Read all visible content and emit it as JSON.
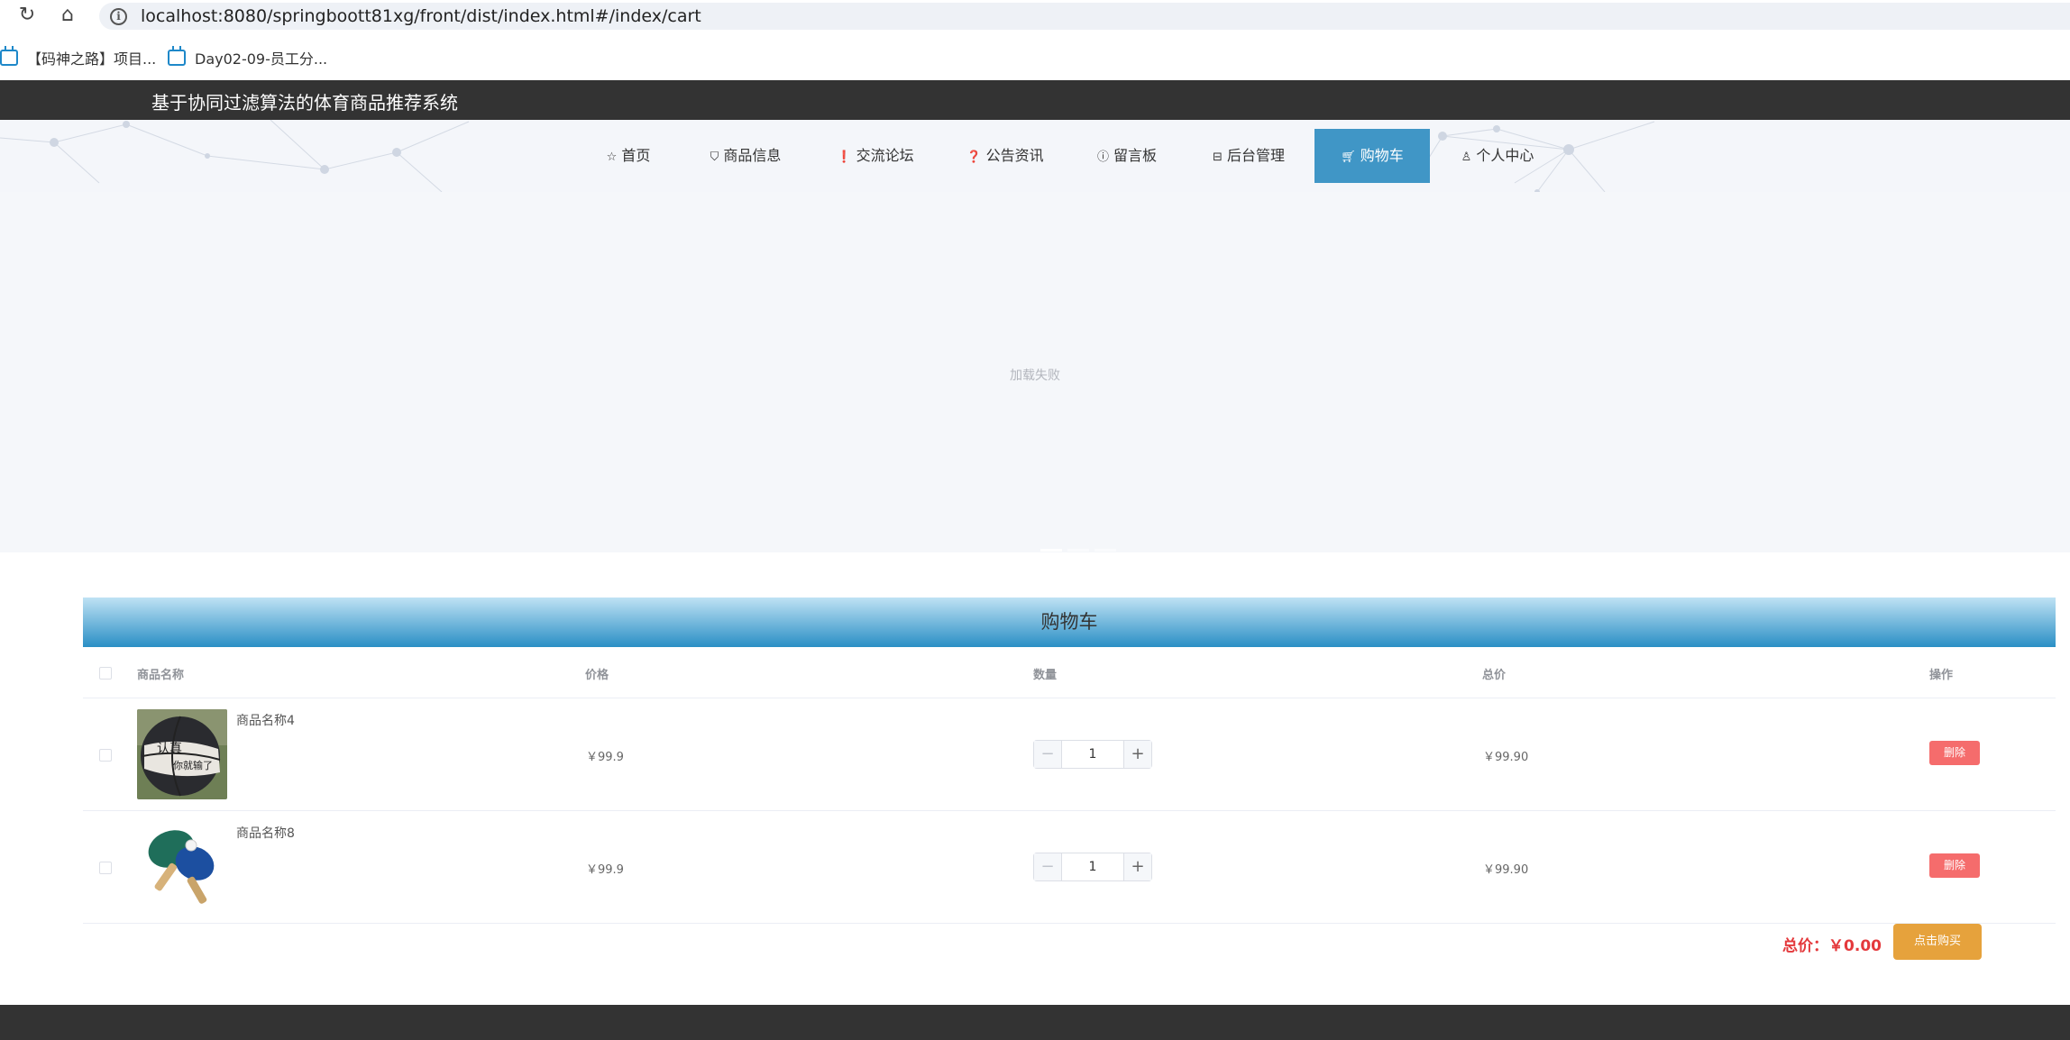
{
  "browser": {
    "url": "localhost:8080/springboott81xg/front/dist/index.html#/index/cart",
    "bookmarks": [
      "【码神之路】项目...",
      "Day02-09-员工分..."
    ]
  },
  "site": {
    "title": "基于协同过滤算法的体育商品推荐系统",
    "nav": [
      {
        "label": "首页",
        "icon": "star-icon"
      },
      {
        "label": "商品信息",
        "icon": "bag-icon"
      },
      {
        "label": "交流论坛",
        "icon": "exclamation-icon"
      },
      {
        "label": "公告资讯",
        "icon": "question-icon"
      },
      {
        "label": "留言板",
        "icon": "info-icon"
      },
      {
        "label": "后台管理",
        "icon": "briefcase-icon"
      },
      {
        "label": "购物车",
        "icon": "cart-icon",
        "active": true
      },
      {
        "label": "个人中心",
        "icon": "user-icon"
      }
    ]
  },
  "banner": {
    "status": "加载失败",
    "slides": 3,
    "active_slide": 0
  },
  "cart": {
    "title": "购物车",
    "columns": {
      "name": "商品名称",
      "price": "价格",
      "qty": "数量",
      "total": "总价",
      "action": "操作"
    },
    "items": [
      {
        "name": "商品名称4",
        "price": "￥99.9",
        "qty": "1",
        "total": "￥99.90",
        "delete": "删除",
        "thumb": "basketball"
      },
      {
        "name": "商品名称8",
        "price": "￥99.9",
        "qty": "1",
        "total": "￥99.90",
        "delete": "删除",
        "thumb": "ping-pong-paddles"
      }
    ],
    "total_label": "总价：￥0.00",
    "buy_label": "点击购买"
  },
  "colors": {
    "header": "#333333",
    "accent": "#4096c6",
    "danger": "#f56c6c",
    "warning": "#e6a23c",
    "price": "#e4393c"
  }
}
